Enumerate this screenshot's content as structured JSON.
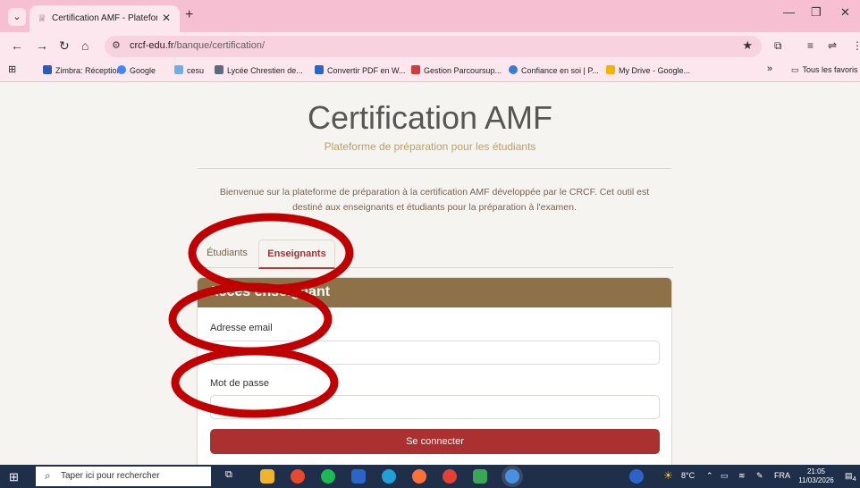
{
  "browser": {
    "tab_title": "Certification AMF - Plateforme",
    "tab_close": "✕",
    "new_tab": "+",
    "url_host": "crcf-edu.fr",
    "url_path": "/banque/certification/",
    "bookmarks": [
      {
        "label": "Zimbra: Réception",
        "color": "#2c5bb8"
      },
      {
        "label": "Google",
        "color": "#4285f4"
      },
      {
        "label": "cesu",
        "color": "#6fb0e0"
      },
      {
        "label": "Lycée Chrestien de...",
        "color": "#5c6b80"
      },
      {
        "label": "Convertir PDF en W...",
        "color": "#2b65c8"
      },
      {
        "label": "Gestion Parcoursup...",
        "color": "#d23b3b"
      },
      {
        "label": "Confiance en soi | P...",
        "color": "#3b7bd2"
      },
      {
        "label": "My Drive - Google...",
        "color": "#f4b400"
      }
    ],
    "bookmarks_overflow": "»",
    "all_favorites": "Tous les favoris"
  },
  "page": {
    "title": "Certification AMF",
    "subtitle": "Plateforme de préparation pour les étudiants",
    "intro_line1": "Bienvenue sur la plateforme de préparation à la certification AMF développée par le CRCF. Cet outil est",
    "intro_line2": "destiné aux enseignants et étudiants pour la préparation à l'examen.",
    "tabs": {
      "students": "Étudiants",
      "teachers": "Enseignants"
    },
    "card_title": "Accès enseignant",
    "email_label": "Adresse email",
    "password_label": "Mot de passe",
    "submit": "Se connecter"
  },
  "taskbar": {
    "search_placeholder": "Taper ici pour rechercher",
    "weather": "8°C",
    "language": "FRA",
    "time": "21:05",
    "date": "11/03/2026",
    "notifications": "4"
  },
  "colors": {
    "accent": "#ab3030",
    "card_header": "#8f7148",
    "annotation": "#c00000"
  }
}
